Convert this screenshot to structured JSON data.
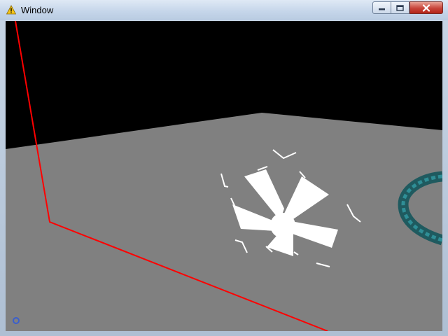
{
  "window": {
    "title": "Window",
    "title_icon": "warning-icon",
    "controls": {
      "minimize": "minimize-icon",
      "maximize": "maximize-icon",
      "close": "close-icon"
    }
  },
  "scene": {
    "sky_color": "#000000",
    "floor_color": "#808080",
    "axis_line_color": "#ff0000",
    "star_color": "#ffffff",
    "torus_color": "#1f5a5f",
    "marker_color": "#3a5fcd"
  }
}
